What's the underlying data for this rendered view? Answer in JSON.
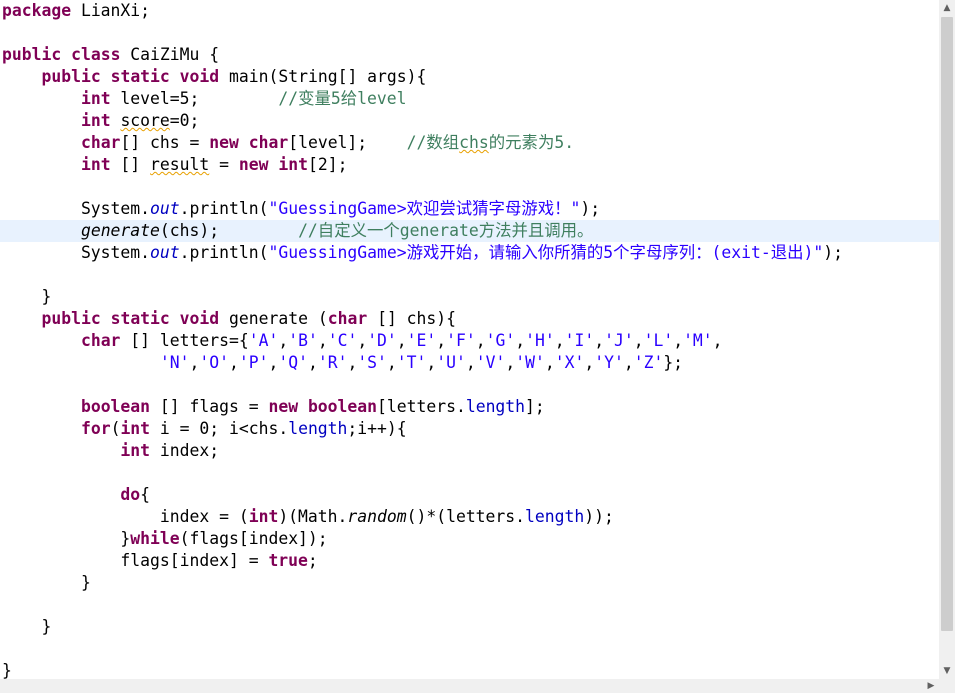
{
  "editor": {
    "lines": [
      [
        {
          "t": "package",
          "c": "kw"
        },
        {
          "t": " LianXi;"
        }
      ],
      [],
      [
        {
          "t": "public",
          "c": "kw"
        },
        {
          "t": " "
        },
        {
          "t": "class",
          "c": "kw"
        },
        {
          "t": " CaiZiMu {"
        }
      ],
      [
        {
          "t": "    "
        },
        {
          "t": "public",
          "c": "kw"
        },
        {
          "t": " "
        },
        {
          "t": "static",
          "c": "kw"
        },
        {
          "t": " "
        },
        {
          "t": "void",
          "c": "kw"
        },
        {
          "t": " main(String[] args){"
        }
      ],
      [
        {
          "t": "        "
        },
        {
          "t": "int",
          "c": "kw"
        },
        {
          "t": " level=5;        "
        },
        {
          "t": "//变量5给level",
          "c": "cm"
        }
      ],
      [
        {
          "t": "        "
        },
        {
          "t": "int",
          "c": "kw"
        },
        {
          "t": " "
        },
        {
          "t": "score",
          "c": "warn"
        },
        {
          "t": "=0;"
        }
      ],
      [
        {
          "t": "        "
        },
        {
          "t": "char",
          "c": "kw"
        },
        {
          "t": "[] chs = "
        },
        {
          "t": "new",
          "c": "kw"
        },
        {
          "t": " "
        },
        {
          "t": "char",
          "c": "kw"
        },
        {
          "t": "[level];    "
        },
        {
          "t": "//数组",
          "c": "cm"
        },
        {
          "t": "chs",
          "c": "cm warn"
        },
        {
          "t": "的元素为5.",
          "c": "cm"
        }
      ],
      [
        {
          "t": "        "
        },
        {
          "t": "int",
          "c": "kw"
        },
        {
          "t": " [] "
        },
        {
          "t": "result",
          "c": "warn"
        },
        {
          "t": " = "
        },
        {
          "t": "new",
          "c": "kw"
        },
        {
          "t": " "
        },
        {
          "t": "int",
          "c": "kw"
        },
        {
          "t": "[2];"
        }
      ],
      [],
      [
        {
          "t": "        System."
        },
        {
          "t": "out",
          "c": "fld"
        },
        {
          "t": ".println("
        },
        {
          "t": "\"GuessingGame>欢迎尝试猜字母游戏！\"",
          "c": "str"
        },
        {
          "t": ");"
        }
      ],
      [
        {
          "t": "        "
        },
        {
          "t": "generate",
          "c": "ital"
        },
        {
          "t": "(chs);        "
        },
        {
          "t": "//自定义一个generate方法并且调用。",
          "c": "cm"
        }
      ],
      [
        {
          "t": "        System."
        },
        {
          "t": "out",
          "c": "fld"
        },
        {
          "t": ".println("
        },
        {
          "t": "\"GuessingGame>游戏开始，请输入你所猜的5个字母序列：(exit-退出)\"",
          "c": "str"
        },
        {
          "t": ");"
        }
      ],
      [],
      [
        {
          "t": "    }"
        }
      ],
      [
        {
          "t": "    "
        },
        {
          "t": "public",
          "c": "kw"
        },
        {
          "t": " "
        },
        {
          "t": "static",
          "c": "kw"
        },
        {
          "t": " "
        },
        {
          "t": "void",
          "c": "kw"
        },
        {
          "t": " generate ("
        },
        {
          "t": "char",
          "c": "kw"
        },
        {
          "t": " [] chs){"
        }
      ],
      [
        {
          "t": "        "
        },
        {
          "t": "char",
          "c": "kw"
        },
        {
          "t": " [] letters={"
        },
        {
          "t": "'A'",
          "c": "str"
        },
        {
          "t": ","
        },
        {
          "t": "'B'",
          "c": "str"
        },
        {
          "t": ","
        },
        {
          "t": "'C'",
          "c": "str"
        },
        {
          "t": ","
        },
        {
          "t": "'D'",
          "c": "str"
        },
        {
          "t": ","
        },
        {
          "t": "'E'",
          "c": "str"
        },
        {
          "t": ","
        },
        {
          "t": "'F'",
          "c": "str"
        },
        {
          "t": ","
        },
        {
          "t": "'G'",
          "c": "str"
        },
        {
          "t": ","
        },
        {
          "t": "'H'",
          "c": "str"
        },
        {
          "t": ","
        },
        {
          "t": "'I'",
          "c": "str"
        },
        {
          "t": ","
        },
        {
          "t": "'J'",
          "c": "str"
        },
        {
          "t": ","
        },
        {
          "t": "'L'",
          "c": "str"
        },
        {
          "t": ","
        },
        {
          "t": "'M'",
          "c": "str"
        },
        {
          "t": ","
        }
      ],
      [
        {
          "t": "                "
        },
        {
          "t": "'N'",
          "c": "str"
        },
        {
          "t": ","
        },
        {
          "t": "'O'",
          "c": "str"
        },
        {
          "t": ","
        },
        {
          "t": "'P'",
          "c": "str"
        },
        {
          "t": ","
        },
        {
          "t": "'Q'",
          "c": "str"
        },
        {
          "t": ","
        },
        {
          "t": "'R'",
          "c": "str"
        },
        {
          "t": ","
        },
        {
          "t": "'S'",
          "c": "str"
        },
        {
          "t": ","
        },
        {
          "t": "'T'",
          "c": "str"
        },
        {
          "t": ","
        },
        {
          "t": "'U'",
          "c": "str"
        },
        {
          "t": ","
        },
        {
          "t": "'V'",
          "c": "str"
        },
        {
          "t": ","
        },
        {
          "t": "'W'",
          "c": "str"
        },
        {
          "t": ","
        },
        {
          "t": "'X'",
          "c": "str"
        },
        {
          "t": ","
        },
        {
          "t": "'Y'",
          "c": "str"
        },
        {
          "t": ","
        },
        {
          "t": "'Z'",
          "c": "str"
        },
        {
          "t": "};"
        }
      ],
      [],
      [
        {
          "t": "        "
        },
        {
          "t": "boolean",
          "c": "kw"
        },
        {
          "t": " [] flags = "
        },
        {
          "t": "new",
          "c": "kw"
        },
        {
          "t": " "
        },
        {
          "t": "boolean",
          "c": "kw"
        },
        {
          "t": "[letters."
        },
        {
          "t": "length",
          "c": "fldn"
        },
        {
          "t": "];"
        }
      ],
      [
        {
          "t": "        "
        },
        {
          "t": "for",
          "c": "kw"
        },
        {
          "t": "("
        },
        {
          "t": "int",
          "c": "kw"
        },
        {
          "t": " i = 0; i<chs."
        },
        {
          "t": "length",
          "c": "fldn"
        },
        {
          "t": ";i++){"
        }
      ],
      [
        {
          "t": "            "
        },
        {
          "t": "int",
          "c": "kw"
        },
        {
          "t": " index;"
        }
      ],
      [],
      [
        {
          "t": "            "
        },
        {
          "t": "do",
          "c": "kw"
        },
        {
          "t": "{"
        }
      ],
      [
        {
          "t": "                index = ("
        },
        {
          "t": "int",
          "c": "kw"
        },
        {
          "t": ")(Math."
        },
        {
          "t": "random",
          "c": "ital"
        },
        {
          "t": "()*(letters."
        },
        {
          "t": "length",
          "c": "fldn"
        },
        {
          "t": "));"
        }
      ],
      [
        {
          "t": "            }"
        },
        {
          "t": "while",
          "c": "kw"
        },
        {
          "t": "(flags[index]);"
        }
      ],
      [
        {
          "t": "            flags[index] = "
        },
        {
          "t": "true",
          "c": "kw"
        },
        {
          "t": ";"
        }
      ],
      [
        {
          "t": "        }"
        }
      ],
      [],
      [
        {
          "t": "    }"
        }
      ],
      [],
      [
        {
          "t": "}"
        }
      ]
    ],
    "current_line_index": 10
  },
  "scrollbar": {
    "up_arrow": "▲",
    "down_arrow": "▼",
    "right_arrow": "▶"
  }
}
